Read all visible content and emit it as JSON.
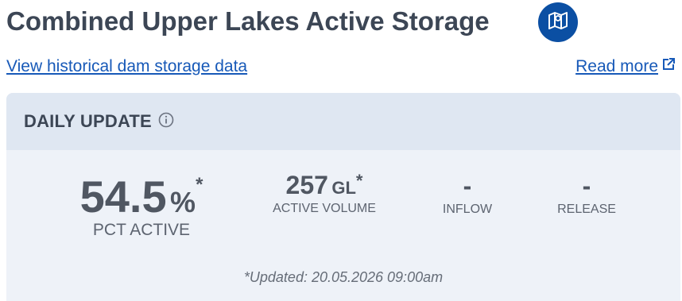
{
  "header": {
    "title": "Combined Upper Lakes Active Storage",
    "map_icon": "map-icon"
  },
  "links": {
    "historical": "View historical dam storage data",
    "read_more": "Read more",
    "external_icon": "external-link-icon"
  },
  "daily_update": {
    "heading": "DAILY UPDATE",
    "info_icon": "info-icon",
    "pct_active": {
      "value": "54.5",
      "unit": "%",
      "asterisk": "*",
      "label": "PCT ACTIVE"
    },
    "active_volume": {
      "value": "257",
      "unit": "GL",
      "asterisk": "*",
      "label": "ACTIVE VOLUME"
    },
    "inflow": {
      "value": "-",
      "label": "INFLOW"
    },
    "release": {
      "value": "-",
      "label": "RELEASE"
    },
    "updated": "*Updated: 20.05.2026 09:00am"
  },
  "colors": {
    "brand_blue": "#0b4fa3",
    "link": "#1759b8",
    "card_bg": "#eef2f8",
    "card_header_bg": "#dfe7f2"
  }
}
